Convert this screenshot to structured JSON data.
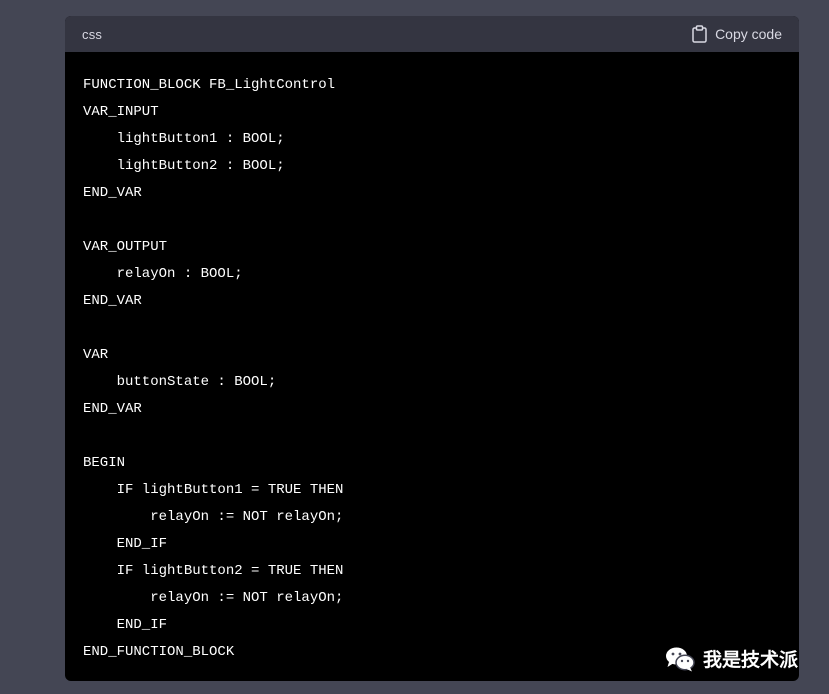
{
  "code_block": {
    "language": "css",
    "copy_label": "Copy code",
    "lines": [
      "FUNCTION_BLOCK FB_LightControl",
      "VAR_INPUT",
      "    lightButton1 : BOOL;",
      "    lightButton2 : BOOL;",
      "END_VAR",
      "",
      "VAR_OUTPUT",
      "    relayOn : BOOL;",
      "END_VAR",
      "",
      "VAR",
      "    buttonState : BOOL;",
      "END_VAR",
      "",
      "BEGIN",
      "    IF lightButton1 = TRUE THEN",
      "        relayOn := NOT relayOn;",
      "    END_IF",
      "    IF lightButton2 = TRUE THEN",
      "        relayOn := NOT relayOn;",
      "    END_IF",
      "END_FUNCTION_BLOCK"
    ]
  },
  "watermark": {
    "text": "我是技术派"
  },
  "icons": {
    "copy": "clipboard-icon",
    "watermark": "wechat-icon"
  },
  "colors": {
    "page_background": "#444654",
    "header_background": "#343541",
    "code_background": "#000000",
    "code_text": "#ffffff"
  }
}
